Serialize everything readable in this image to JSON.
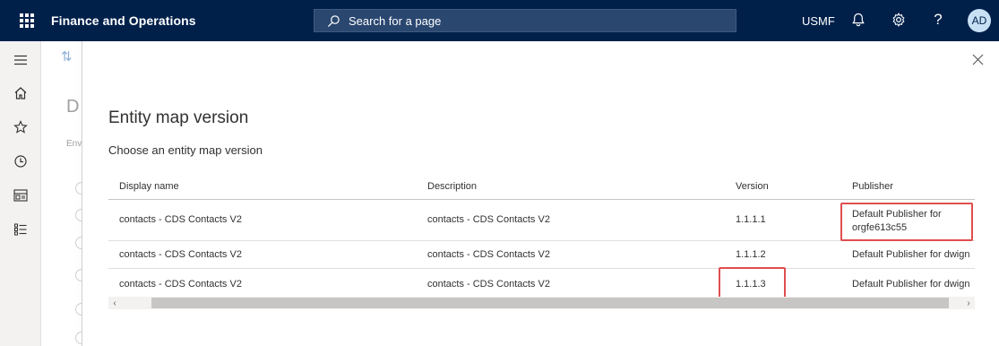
{
  "topbar": {
    "app_title": "Finance and Operations",
    "search_placeholder": "Search for a page",
    "company": "USMF",
    "avatar_initials": "AD",
    "colors": {
      "background": "#00204a",
      "search": "#2a4770",
      "avatar": "#c7e0f4"
    }
  },
  "rail": {
    "icons": [
      "hamburger-icon",
      "home-icon",
      "star-icon",
      "clock-icon",
      "workspace-icon",
      "list-icon"
    ]
  },
  "background_page": {
    "title_fragment": "D",
    "label_fragment": "Env"
  },
  "dialog": {
    "title": "Entity map version",
    "subtitle": "Choose an entity map version",
    "grid": {
      "columns": [
        "Display name",
        "Description",
        "Version",
        "Publisher"
      ],
      "rows": [
        {
          "display_name": "contacts - CDS Contacts V2",
          "description": "contacts - CDS Contacts V2",
          "version": "1.1.1.1",
          "publisher": "Default Publisher for orgfe613c55"
        },
        {
          "display_name": "contacts - CDS Contacts V2",
          "description": "contacts - CDS Contacts V2",
          "version": "1.1.1.2",
          "publisher": "Default Publisher for dwign"
        },
        {
          "display_name": "contacts - CDS Contacts V2",
          "description": "contacts - CDS Contacts V2",
          "version": "1.1.1.3",
          "publisher": "Default Publisher for dwign"
        }
      ]
    },
    "highlight_color": "#e04e4e"
  }
}
